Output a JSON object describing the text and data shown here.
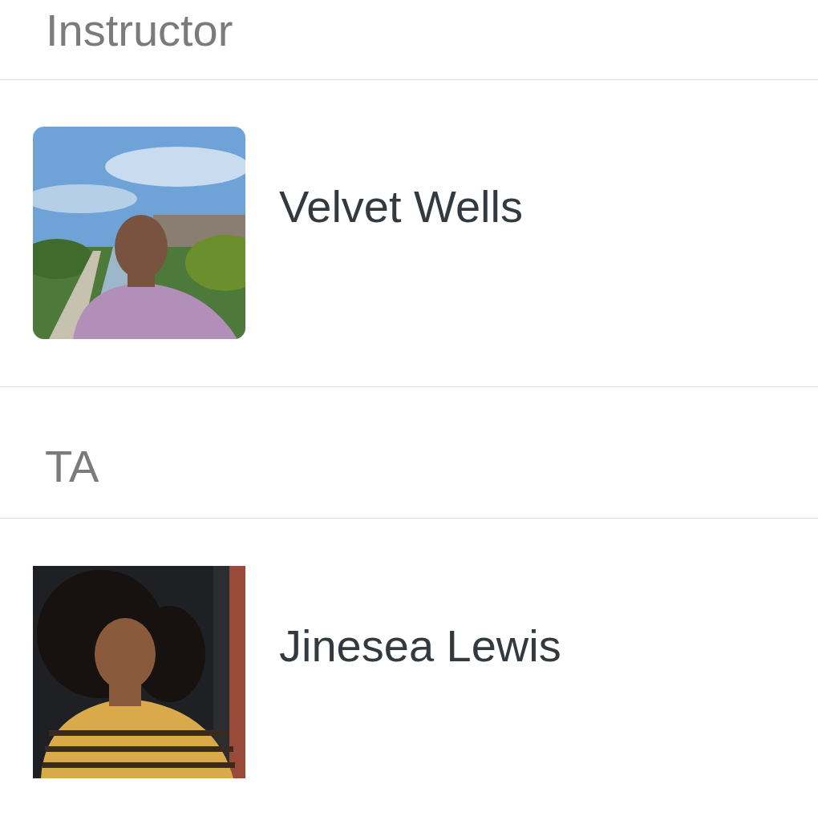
{
  "sections": [
    {
      "heading": "Instructor",
      "people": [
        {
          "name": "Velvet Wells",
          "photo": {
            "kind": "picture",
            "rounded": true
          }
        }
      ]
    },
    {
      "heading": "TA",
      "people": [
        {
          "name": "Jinesea Lewis",
          "photo": {
            "kind": "picture",
            "rounded": false
          }
        }
      ]
    }
  ]
}
